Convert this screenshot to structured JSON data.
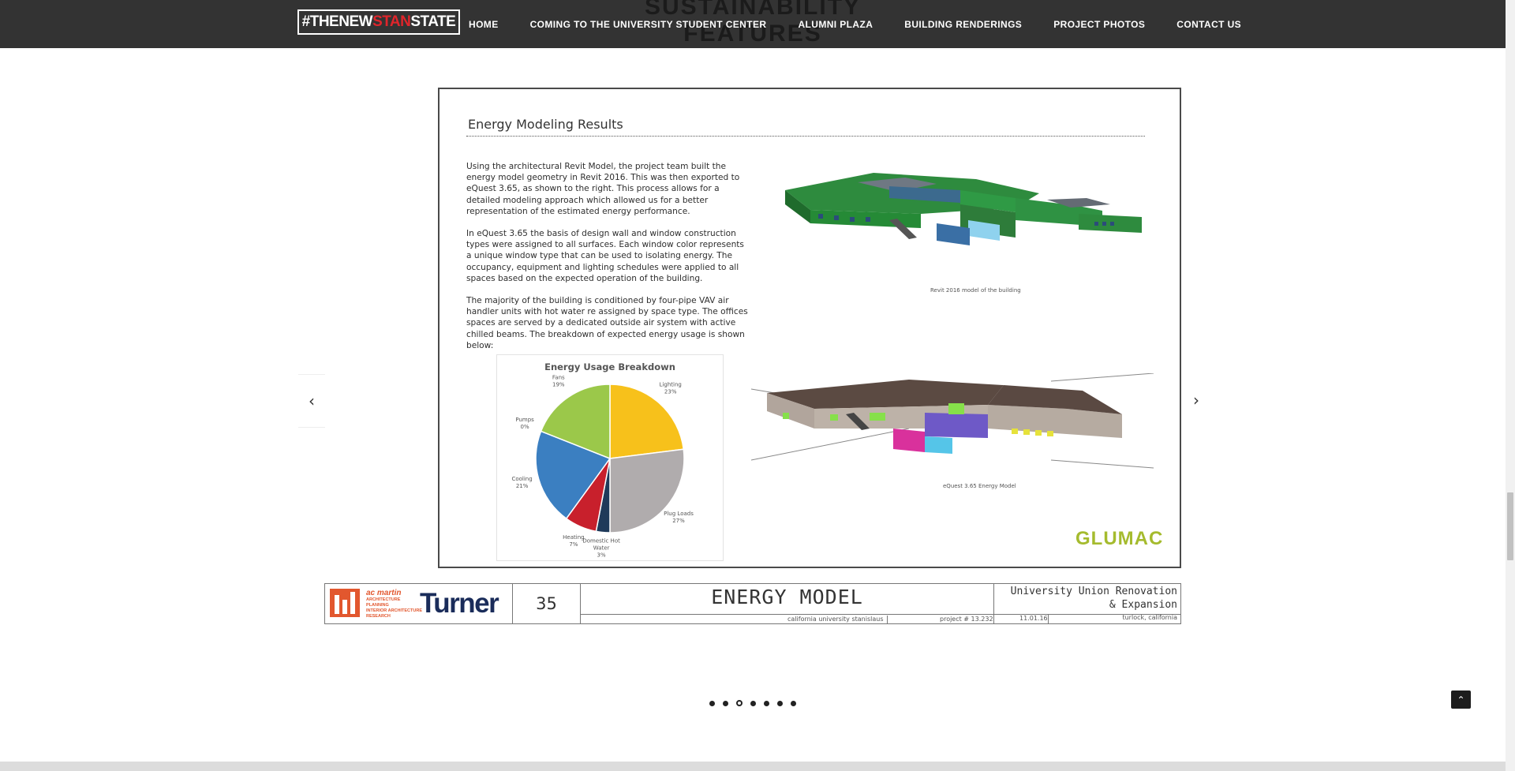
{
  "nav": {
    "logo_pre": "#THENEW",
    "logo_red": "STAN",
    "logo_post": "STATE",
    "links": [
      "HOME",
      "COMING TO THE UNIVERSITY STUDENT CENTER",
      "ALUMNI PLAZA",
      "BUILDING RENDERINGS",
      "PROJECT PHOTOS",
      "CONTACT US"
    ]
  },
  "section_heading": [
    "SUSTAINABILITY",
    "FEATURES"
  ],
  "slide": {
    "title": "Energy Modeling Results",
    "paragraphs": [
      "Using the architectural Revit Model, the project team built the energy model geometry in Revit 2016. This was then exported to eQuest 3.65, as shown to the right. This process allows for a detailed modeling approach which allowed us for a better representation of the estimated energy performance.",
      "In eQuest 3.65 the basis of design wall and window construction types were assigned to all surfaces. Each window color represents a unique window type that can be used to isolating energy. The occupancy, equipment and lighting schedules were applied to all spaces based on the expected operation of the building.",
      "The majority of the building is conditioned by four-pipe VAV air handler units with hot water re assigned by space type. The offices spaces are served by a dedicated outside air system with active chilled beams. The breakdown of expected energy usage is shown below:"
    ],
    "caption_revit": "Revit 2016 model of the building",
    "caption_equest": "eQuest 3.65 Energy Model",
    "brand": "GLUMAC"
  },
  "chart_data": {
    "type": "pie",
    "title": "Energy Usage Breakdown",
    "categories": [
      "Lighting",
      "Plug Loads",
      "Domestic Hot Water",
      "Heating",
      "Cooling",
      "Pumps",
      "Fans"
    ],
    "values": [
      23,
      27,
      3,
      7,
      21,
      0,
      19
    ],
    "label_lines": [
      [
        "Lighting",
        "23%"
      ],
      [
        "Plug Loads",
        "27%"
      ],
      [
        "Domestic Hot",
        "Water",
        "3%"
      ],
      [
        "Heating",
        "7%"
      ],
      [
        "Cooling",
        "21%"
      ],
      [
        "Pumps",
        "0%"
      ],
      [
        "Fans",
        "19%"
      ]
    ],
    "colors": [
      "#f7c11b",
      "#b0acad",
      "#1f3a5a",
      "#c8202c",
      "#3b7fc1",
      "#2d5a8a",
      "#9bc84a"
    ],
    "legend": "none"
  },
  "titleblock": {
    "firm_name": "ac martin",
    "firm_services": [
      "ARCHITECTURE",
      "PLANNING",
      "INTERIOR ARCHITECTURE",
      "RESEARCH"
    ],
    "contractor": "Turner",
    "sheet": "35",
    "sheet_title": "ENERGY MODEL",
    "client": "california university stanislaus",
    "project_no": "project # 13.232",
    "date": "11.01.16",
    "project_line1": "University Union Renovation",
    "project_line2": "& Expansion",
    "location": "turlock, california"
  },
  "carousel": {
    "prev": "‹",
    "next": "›",
    "count": 7,
    "active": 2
  },
  "to_top": "⌃"
}
